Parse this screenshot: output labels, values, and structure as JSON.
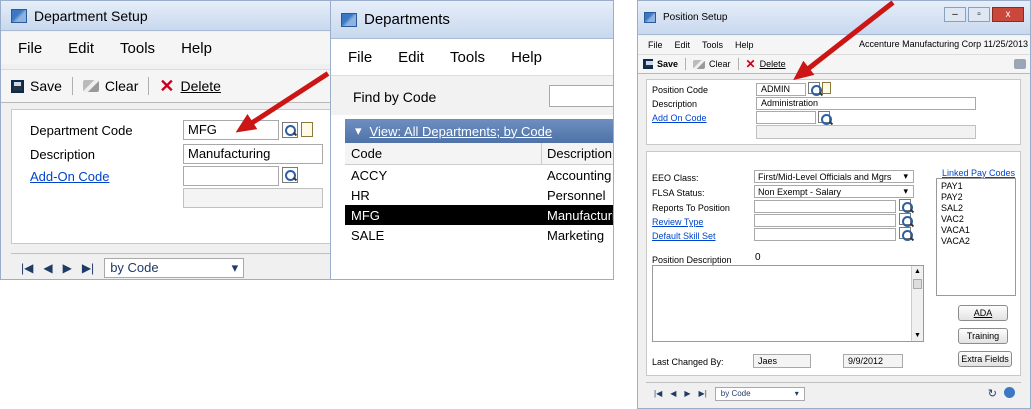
{
  "dept_setup": {
    "title": "Department Setup",
    "menu": [
      "File",
      "Edit",
      "Tools",
      "Help"
    ],
    "toolbar": {
      "save": "Save",
      "clear": "Clear",
      "delete": "Delete"
    },
    "fields": {
      "code_label": "Department Code",
      "code_value": "MFG",
      "desc_label": "Description",
      "desc_value": "Manufacturing",
      "addon_label": "Add-On Code",
      "addon_value": ""
    },
    "nav": {
      "sort": "by Code"
    }
  },
  "departments": {
    "title": "Departments",
    "menu": [
      "File",
      "Edit",
      "Tools",
      "Help"
    ],
    "find_label": "Find by Code",
    "view_label": "View: All Departments; by Code",
    "columns": [
      "Code",
      "Description"
    ],
    "rows": [
      {
        "code": "ACCY",
        "desc": "Accounting"
      },
      {
        "code": "HR",
        "desc": "Personnel"
      },
      {
        "code": "MFG",
        "desc": "Manufacturin"
      },
      {
        "code": "SALE",
        "desc": "Marketing"
      }
    ],
    "selected_row": 2
  },
  "position_setup": {
    "title": "Position Setup",
    "menu": [
      "File",
      "Edit",
      "Tools",
      "Help"
    ],
    "company": "Accenture Manufacturing Corp 11/25/2013",
    "toolbar": {
      "save": "Save",
      "clear": "Clear",
      "delete": "Delete"
    },
    "fields": {
      "code_label": "Position Code",
      "code_value": "ADMIN",
      "desc_label": "Description",
      "desc_value": "Administration",
      "addon_label": "Add On Code",
      "eeo_label": "EEO Class:",
      "eeo_value": "First/Mid-Level Officials and Mgrs",
      "flsa_label": "FLSA Status:",
      "flsa_value": "Non Exempt - Salary",
      "reports_label": "Reports To Position",
      "review_label": "Review Type",
      "skill_label": "Default Skill Set",
      "posdesc_label": "Position Description",
      "lastchanged_label": "Last Changed By:",
      "lastchanged_user": "Jaes",
      "lastchanged_date": "9/9/2012"
    },
    "linked_pay_label": "Linked Pay Codes",
    "pay_codes": [
      "PAY1",
      "PAY2",
      "SAL2",
      "VAC2",
      "VACA1",
      "VACA2"
    ],
    "buttons": {
      "ada": "ADA",
      "training": "Training",
      "extra": "Extra Fields"
    },
    "nav": {
      "sort": "by Code"
    }
  },
  "colors": {
    "arrow": "#cc1616",
    "link": "#0044cc",
    "selection": "#000000"
  }
}
